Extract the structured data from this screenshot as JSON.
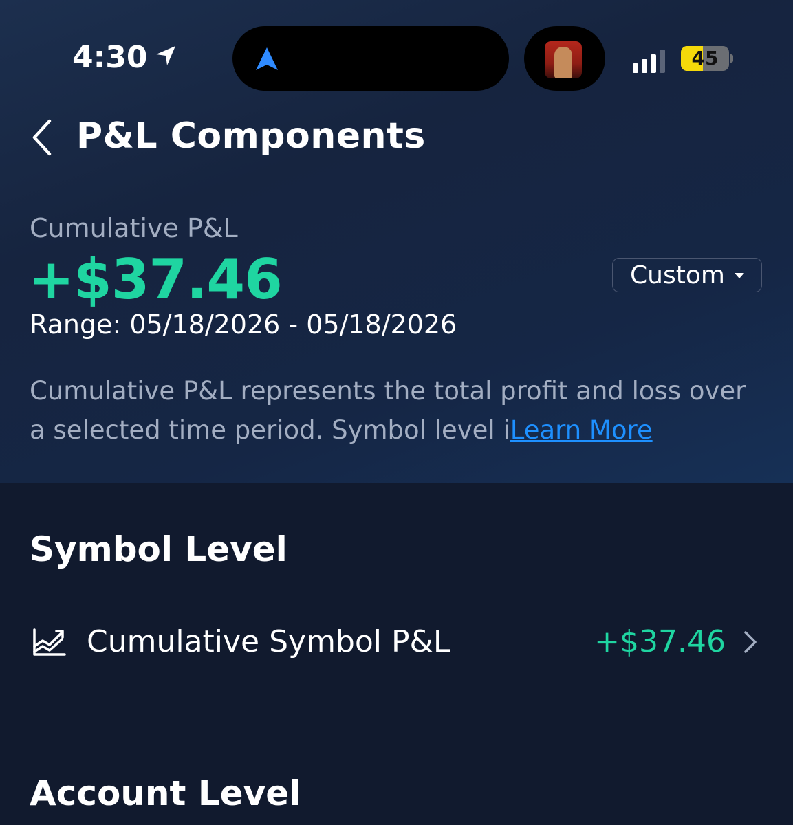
{
  "status_bar": {
    "time": "4:30",
    "battery_percent": "45",
    "battery_level": 0.45,
    "signal_bars": 3,
    "signal_bars_total": 4
  },
  "header": {
    "title": "P&L Components"
  },
  "summary": {
    "label": "Cumulative P&L",
    "value": "+$37.46",
    "range": "Range: 05/18/2026 - 05/18/2026",
    "range_selector": "Custom",
    "description": "Cumulative P&L represents the total profit and loss over a selected time period. Symbol level i",
    "learn_more": "Learn More"
  },
  "symbol_level": {
    "title": "Symbol Level",
    "items": [
      {
        "label": "Cumulative Symbol P&L",
        "value": "+$37.46",
        "icon": "chart-trend-icon"
      }
    ]
  },
  "account_level": {
    "title": "Account Level"
  },
  "colors": {
    "accent_green": "#1fd5a1",
    "link_blue": "#1e90ff",
    "background": "#111a2e",
    "muted_text": "#a3aec2"
  }
}
